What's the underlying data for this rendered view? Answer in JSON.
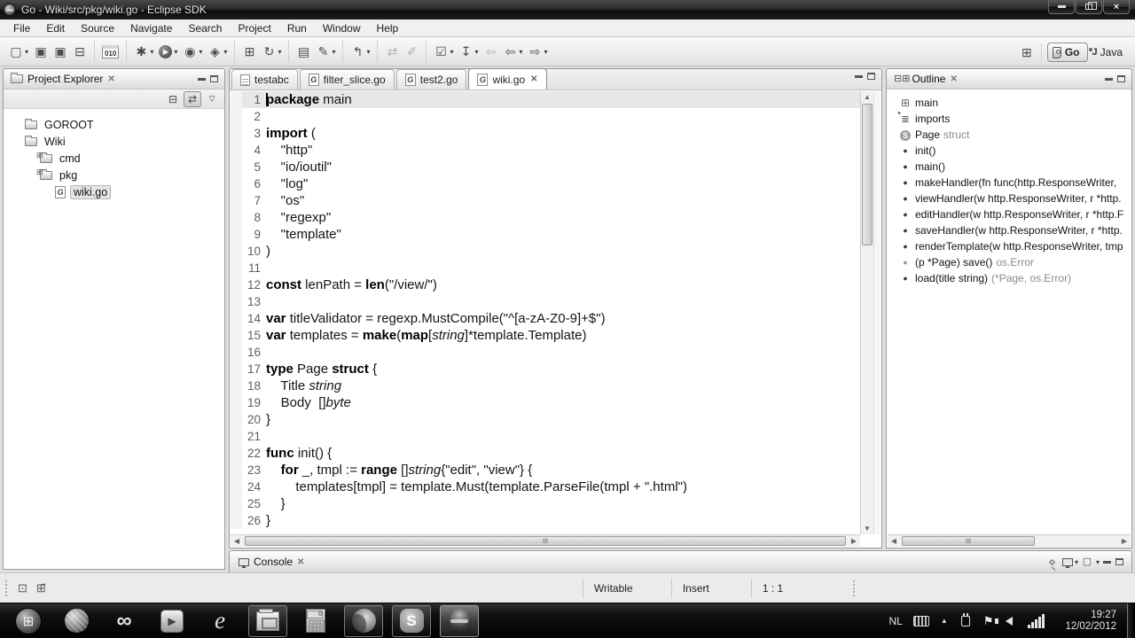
{
  "window": {
    "title": "Go - Wiki/src/pkg/wiki.go - Eclipse SDK"
  },
  "menu": {
    "items": [
      "File",
      "Edit",
      "Source",
      "Navigate",
      "Search",
      "Project",
      "Run",
      "Window",
      "Help"
    ]
  },
  "toolbar": {
    "groups": [
      {
        "items": [
          {
            "name": "new-wizard-button",
            "glyph": "▢",
            "dd": true
          },
          {
            "name": "save-button",
            "glyph": "▣"
          },
          {
            "name": "save-all-button",
            "glyph": "▣"
          },
          {
            "name": "print-button",
            "glyph": "⊟"
          }
        ]
      },
      {
        "items": [
          {
            "name": "binary-literals-button",
            "glyph": "010",
            "cls": "binbox"
          }
        ]
      },
      {
        "items": [
          {
            "name": "debug-button",
            "glyph": "✱",
            "dd": true
          },
          {
            "name": "run-button",
            "glyph": "▶",
            "cls": "runball",
            "dd": true
          },
          {
            "name": "run-history-button",
            "glyph": "◉",
            "dd": true
          },
          {
            "name": "external-tools-button",
            "glyph": "◈",
            "dd": true
          }
        ]
      },
      {
        "items": [
          {
            "name": "new-project-button",
            "glyph": "⊞"
          },
          {
            "name": "new-element-button",
            "glyph": "↻",
            "dd": true
          }
        ]
      },
      {
        "items": [
          {
            "name": "open-resource-button",
            "glyph": "▤"
          },
          {
            "name": "annotation-pen-button",
            "glyph": "✎",
            "dd": true
          }
        ]
      },
      {
        "items": [
          {
            "name": "last-edit-location-button",
            "glyph": "↰",
            "dd": true
          }
        ]
      },
      {
        "items": [
          {
            "name": "refresh-button",
            "glyph": "⇄",
            "dim": true
          },
          {
            "name": "clear-button",
            "glyph": "✐",
            "dim": true
          }
        ]
      },
      {
        "items": [
          {
            "name": "task-list-button",
            "glyph": "☑",
            "dd": true
          },
          {
            "name": "next-annotation-button",
            "glyph": "↧",
            "dd": true
          },
          {
            "name": "back-to-edit-button",
            "glyph": "⇦",
            "dim": true
          },
          {
            "name": "back-button",
            "glyph": "⇦",
            "dd": true
          },
          {
            "name": "forward-button",
            "glyph": "⇨",
            "dd": true
          }
        ]
      }
    ],
    "perspectives": {
      "open_label": "",
      "go_label": "Go",
      "java_label": "Java"
    }
  },
  "project_explorer": {
    "title": "Project Explorer",
    "tree": [
      {
        "label": "GOROOT",
        "icon": "folder",
        "indent": 0,
        "selected": false
      },
      {
        "label": "Wiki",
        "icon": "folder",
        "indent": 0,
        "selected": false
      },
      {
        "label": "cmd",
        "icon": "package-folder",
        "indent": 1,
        "selected": false
      },
      {
        "label": "pkg",
        "icon": "package-folder",
        "indent": 1,
        "selected": false
      },
      {
        "label": "wiki.go",
        "icon": "go-file",
        "indent": 2,
        "selected": true
      }
    ]
  },
  "editor": {
    "tabs": [
      {
        "label": "testabc",
        "icon": "doc",
        "active": false,
        "closable": false
      },
      {
        "label": "filter_slice.go",
        "icon": "go",
        "active": false,
        "closable": false
      },
      {
        "label": "test2.go",
        "icon": "go",
        "active": false,
        "closable": false
      },
      {
        "label": "wiki.go",
        "icon": "go",
        "active": true,
        "closable": true
      }
    ],
    "close_glyph": "✕",
    "code": [
      [
        [
          "k",
          "package"
        ],
        [
          "p",
          " main"
        ]
      ],
      [],
      [
        [
          "k",
          "import"
        ],
        [
          "p",
          " ("
        ]
      ],
      [
        [
          "p",
          "    \"http\""
        ]
      ],
      [
        [
          "p",
          "    \"io/ioutil\""
        ]
      ],
      [
        [
          "p",
          "    \"log\""
        ]
      ],
      [
        [
          "p",
          "    \"os\""
        ]
      ],
      [
        [
          "p",
          "    \"regexp\""
        ]
      ],
      [
        [
          "p",
          "    \"template\""
        ]
      ],
      [
        [
          "p",
          ")"
        ]
      ],
      [],
      [
        [
          "k",
          "const"
        ],
        [
          "p",
          " lenPath = "
        ],
        [
          "k",
          "len"
        ],
        [
          "p",
          "(\"/view/\")"
        ]
      ],
      [],
      [
        [
          "k",
          "var"
        ],
        [
          "p",
          " titleValidator = regexp.MustCompile(\"^[a-zA-Z0-9]+$\")"
        ]
      ],
      [
        [
          "k",
          "var"
        ],
        [
          "p",
          " templates = "
        ],
        [
          "k",
          "make"
        ],
        [
          "p",
          "("
        ],
        [
          "k",
          "map"
        ],
        [
          "p",
          "["
        ],
        [
          "i",
          "string"
        ],
        [
          "p",
          "]*template.Template)"
        ]
      ],
      [],
      [
        [
          "k",
          "type"
        ],
        [
          "p",
          " Page "
        ],
        [
          "k",
          "struct"
        ],
        [
          "p",
          " {"
        ]
      ],
      [
        [
          "p",
          "    Title "
        ],
        [
          "i",
          "string"
        ]
      ],
      [
        [
          "p",
          "    Body  []"
        ],
        [
          "i",
          "byte"
        ]
      ],
      [
        [
          "p",
          "}"
        ]
      ],
      [],
      [
        [
          "k",
          "func"
        ],
        [
          "p",
          " init() {"
        ]
      ],
      [
        [
          "p",
          "    "
        ],
        [
          "k",
          "for"
        ],
        [
          "p",
          " _, tmpl := "
        ],
        [
          "k",
          "range"
        ],
        [
          "p",
          " []"
        ],
        [
          "i",
          "string"
        ],
        [
          "p",
          "{\"edit\", \"view\"} {"
        ]
      ],
      [
        [
          "p",
          "        templates[tmpl] = template.Must(template.ParseFile(tmpl + \".html\")"
        ]
      ],
      [
        [
          "p",
          "    }"
        ]
      ],
      [
        [
          "p",
          "}"
        ]
      ]
    ]
  },
  "outline": {
    "title": "Outline",
    "items": [
      {
        "icon": "package",
        "label": "main",
        "suffix": ""
      },
      {
        "icon": "imports",
        "label": "imports",
        "suffix": ""
      },
      {
        "icon": "struct",
        "label": "Page",
        "suffix": "struct"
      },
      {
        "icon": "func",
        "label": "init()",
        "suffix": ""
      },
      {
        "icon": "func",
        "label": "main()",
        "suffix": ""
      },
      {
        "icon": "func",
        "label": "makeHandler(fn func(http.ResponseWriter,",
        "suffix": ""
      },
      {
        "icon": "func",
        "label": "viewHandler(w http.ResponseWriter, r *http.",
        "suffix": ""
      },
      {
        "icon": "func",
        "label": "editHandler(w http.ResponseWriter, r *http.F",
        "suffix": ""
      },
      {
        "icon": "func",
        "label": "saveHandler(w http.ResponseWriter, r *http.",
        "suffix": ""
      },
      {
        "icon": "func",
        "label": "renderTemplate(w http.ResponseWriter, tmp",
        "suffix": ""
      },
      {
        "icon": "method",
        "label": "(p *Page) save()",
        "suffix": "os.Error"
      },
      {
        "icon": "func",
        "label": "load(title string)",
        "suffix": "(*Page, os.Error)"
      }
    ]
  },
  "console": {
    "title": "Console"
  },
  "statusbar": {
    "writable": "Writable",
    "insert_mode": "Insert",
    "caret_position": "1 : 1"
  },
  "taskbar": {
    "apps": [
      {
        "name": "start-button",
        "icon": "start",
        "boxed": false,
        "active": false
      },
      {
        "name": "network-globe-icon",
        "icon": "globe",
        "boxed": false,
        "active": false
      },
      {
        "name": "infinity-app-icon",
        "icon": "infinity",
        "boxed": false,
        "active": false
      },
      {
        "name": "media-player-icon",
        "icon": "wmp",
        "boxed": false,
        "active": false
      },
      {
        "name": "internet-explorer-icon",
        "icon": "ie",
        "boxed": false,
        "active": false
      },
      {
        "name": "file-explorer-button",
        "icon": "explorer",
        "boxed": true,
        "active": false
      },
      {
        "name": "calculator-button",
        "icon": "calc",
        "boxed": false,
        "active": false
      },
      {
        "name": "firefox-button",
        "icon": "firefox",
        "boxed": true,
        "active": false
      },
      {
        "name": "skype-button",
        "icon": "skype",
        "boxed": true,
        "active": false
      },
      {
        "name": "eclipse-button",
        "icon": "eclipse",
        "boxed": true,
        "active": true
      }
    ],
    "tray": {
      "language": "NL",
      "time": "19:27",
      "date": "12/02/2012"
    }
  },
  "colors": {
    "chrome_dark": "#1d1d1d",
    "panel_border": "#9b9b9b",
    "current_line": "#e7e7e7",
    "taskbar_bg": "#000000"
  }
}
